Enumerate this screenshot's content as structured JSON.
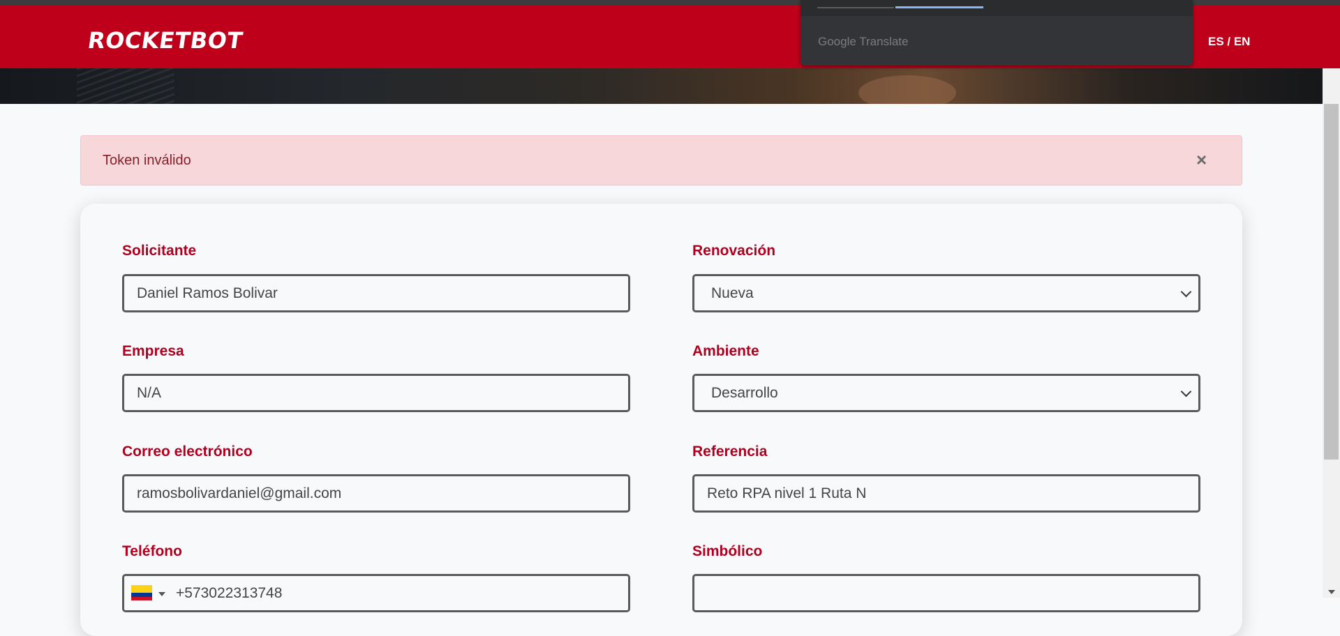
{
  "header": {
    "logo_text": "ROCKETBOT",
    "lang_switch": "ES / EN"
  },
  "translate_popup": {
    "brand": "Google Translate"
  },
  "alert": {
    "message": "Token inválido",
    "close": "×"
  },
  "form": {
    "solicitante": {
      "label": "Solicitante",
      "value": "Daniel Ramos Bolivar"
    },
    "renovacion": {
      "label": "Renovación",
      "value": "Nueva"
    },
    "empresa": {
      "label": "Empresa",
      "value": "N/A"
    },
    "ambiente": {
      "label": "Ambiente",
      "value": "Desarrollo"
    },
    "correo": {
      "label": "Correo electrónico",
      "value": "ramosbolivardaniel@gmail.com"
    },
    "referencia": {
      "label": "Referencia",
      "value": "Reto RPA nivel 1 Ruta N"
    },
    "telefono": {
      "label": "Teléfono",
      "value": "+573022313748",
      "country_flag": "colombia-flag-icon"
    },
    "simbolico": {
      "label": "Simbólico",
      "value": ""
    }
  },
  "colors": {
    "brand_red": "#bf001b",
    "label_red": "#b00020",
    "alert_bg": "#f8d7da",
    "alert_text": "#842029"
  }
}
